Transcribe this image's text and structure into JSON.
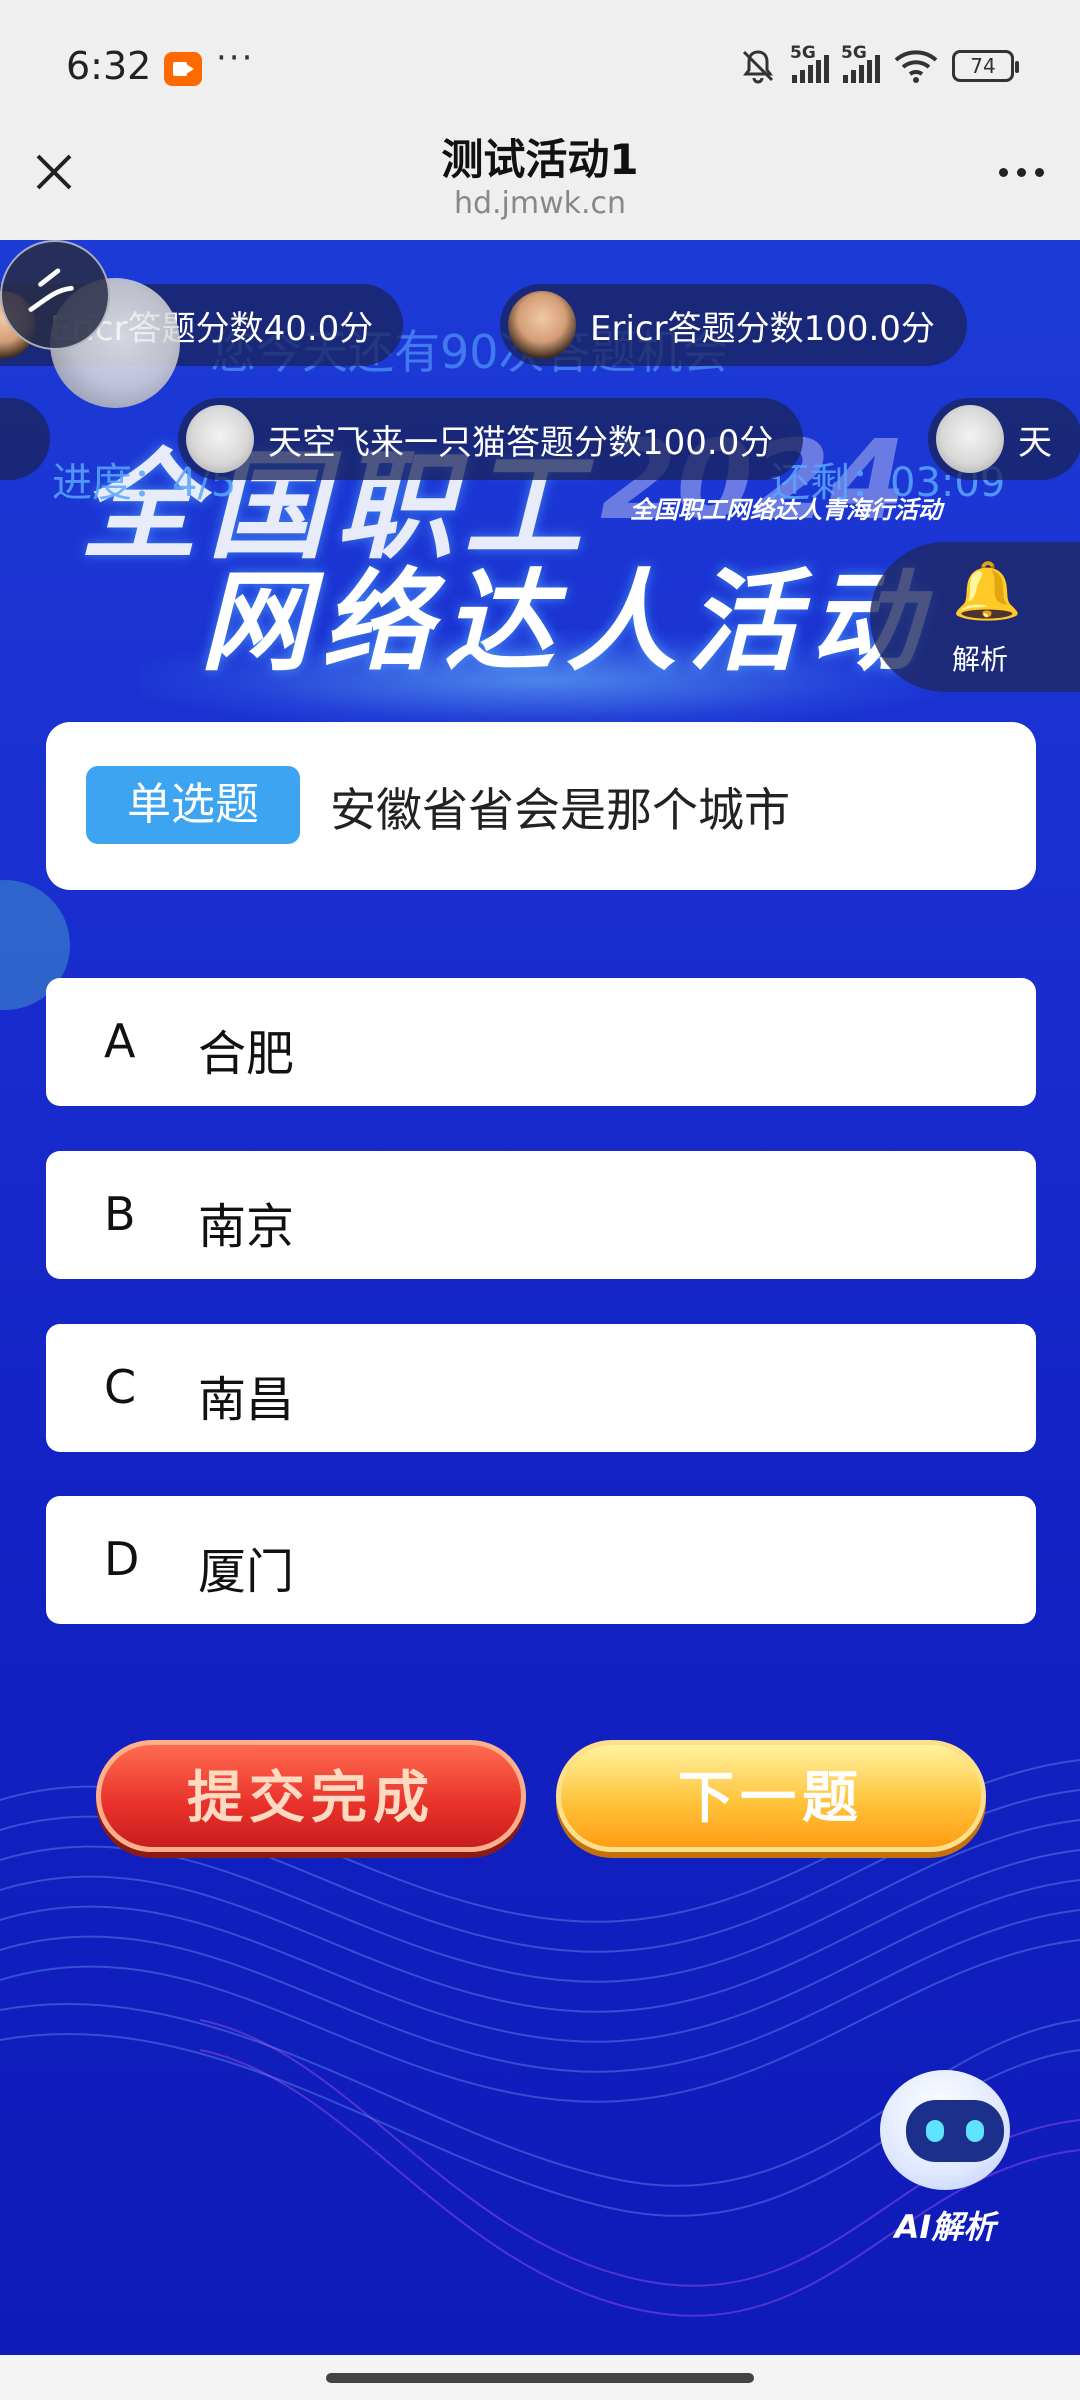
{
  "status": {
    "time": "6:32",
    "dots": "···",
    "network1": "5G",
    "network2": "5G",
    "battery": "74",
    "icons": [
      "video-record-icon",
      "mute-icon",
      "signal-icon",
      "wifi-icon",
      "battery-icon"
    ]
  },
  "header": {
    "title": "测试活动1",
    "url": "hd.jmwk.cn"
  },
  "banner": {
    "line1": "全国职工",
    "year": "2024",
    "line2": "网络达人活动",
    "subtitle": "全国职工网络达人青海行活动"
  },
  "quiz": {
    "remaining_chances": "您今天还有90次答题机会",
    "progress": "进度：4/5",
    "timer": "还剩：03:09"
  },
  "danmaku": [
    {
      "text": "Ericr答题分数40.0分",
      "avatar": "man-avatar"
    },
    {
      "text": "Ericr答题分数100.0分",
      "avatar": "man-avatar"
    },
    {
      "text": "天空飞来一只猫答题分数100.0分",
      "avatar": "cat-avatar"
    },
    {
      "text": "天",
      "avatar": "cat-avatar"
    }
  ],
  "analysis_float": {
    "label": "解析",
    "icon": "bell-icon"
  },
  "question": {
    "type": "单选题",
    "text": "安徽省省会是那个城市"
  },
  "options": [
    {
      "letter": "A",
      "text": "合肥"
    },
    {
      "letter": "B",
      "text": "南京"
    },
    {
      "letter": "C",
      "text": "南昌"
    },
    {
      "letter": "D",
      "text": "厦门"
    }
  ],
  "buttons": {
    "submit": "提交完成",
    "next": "下一题"
  },
  "ai": {
    "label": "AI解析",
    "icon": "robot-icon"
  },
  "colors": {
    "background_blue": "#1a2fd0",
    "type_badge": "#3da4f1",
    "submit_red": "#e8302a",
    "next_orange": "#ffc43d"
  }
}
